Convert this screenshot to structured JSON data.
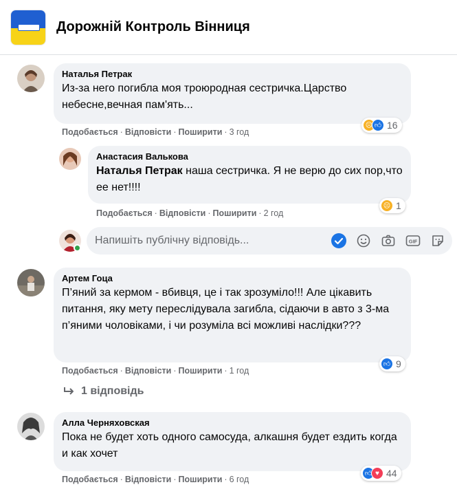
{
  "page": {
    "title": "Дорожній Контроль Вінниця"
  },
  "actions": {
    "like": "Подобається",
    "reply": "Відповісти",
    "share": "Поширити",
    "dot": "·"
  },
  "comments": [
    {
      "author": "Наталья Петрак",
      "text": "Из-за него погибла моя троюродная сестричка.Царство небесне,вечная пам'ять...",
      "time": "3 год",
      "reactions": {
        "icons": [
          "sad",
          "like"
        ],
        "count": "16"
      }
    },
    {
      "author": "Анастасия Валькова",
      "mention": "Наталья Петрак",
      "text": " наша сестричка. Я не верю до сих пор,что ее нет!!!!",
      "time": "2 год",
      "reactions": {
        "icons": [
          "sad"
        ],
        "count": "1"
      }
    },
    {
      "author": "Артем Гоца",
      "text": "П’яний за кермом - вбивця, це і так зрозуміло!!! Але цікавить питання, яку мету переслідувала загибла, сідаючи в авто з 3-ма п’яними чоловіками, і чи розуміла всі можливі наслідки???",
      "time": "1 год",
      "reactions": {
        "icons": [
          "like"
        ],
        "count": "9"
      }
    },
    {
      "author": "Алла Черняховская",
      "text": "Пока не будет хоть одного самосуда, алкашня будет ездить когда и как хочет",
      "time": "6 год",
      "reactions": {
        "icons": [
          "like",
          "love"
        ],
        "count": "44"
      }
    }
  ],
  "reply_box": {
    "placeholder": "Напишіть публічну відповідь..."
  },
  "more_replies": {
    "label": "1 відповідь"
  },
  "colors": {
    "accent": "#1b74e4",
    "secondary_text": "#65676b",
    "bubble": "#f0f2f5",
    "sad": "#f7b125",
    "love": "#f33e58"
  },
  "icons": [
    "checkmark-icon",
    "emoji-icon",
    "camera-icon",
    "gif-icon",
    "sticker-icon",
    "reply-arrow-icon"
  ]
}
